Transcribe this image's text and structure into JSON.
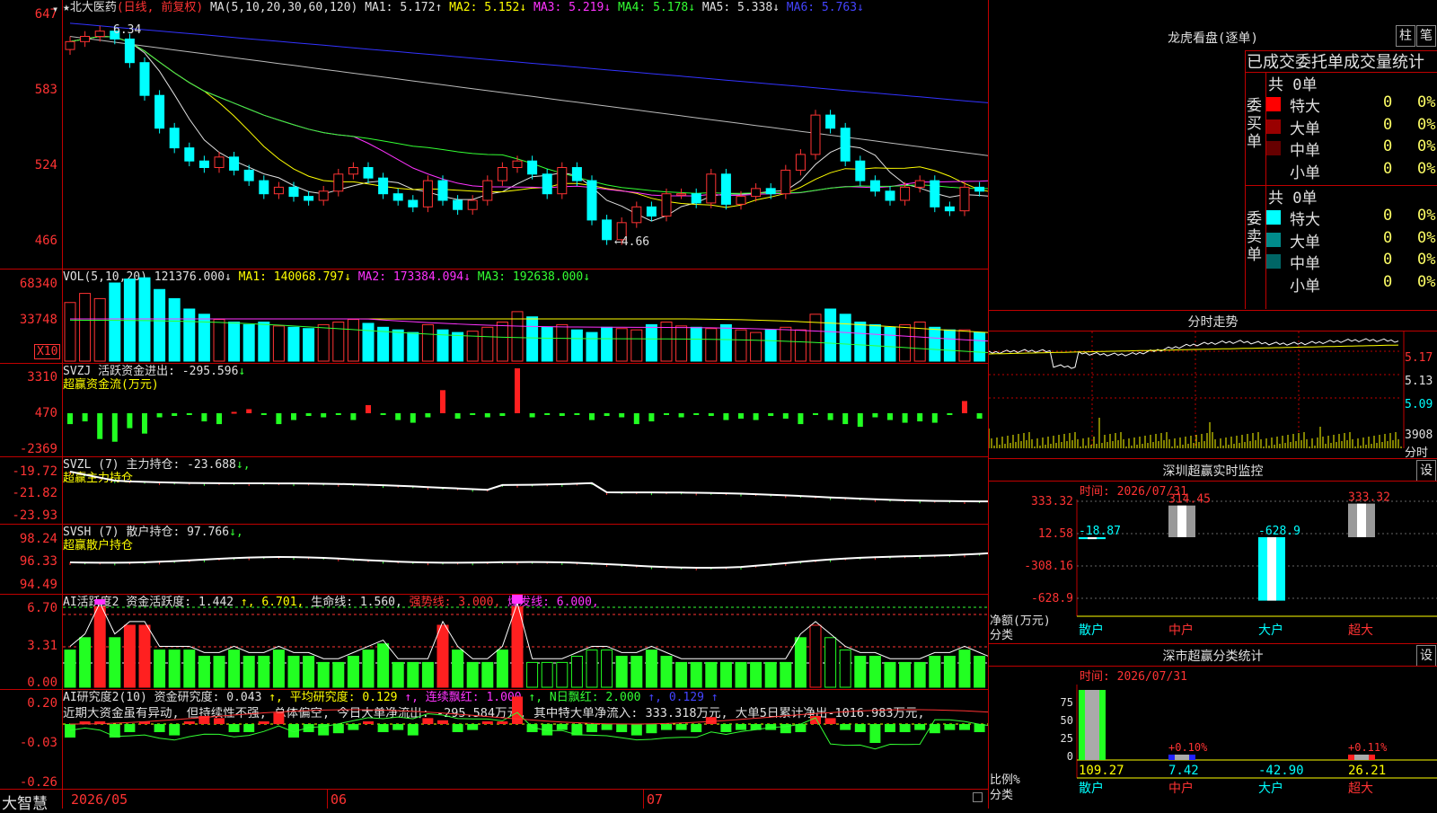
{
  "stock": {
    "star": "★",
    "name": "北大医药",
    "mode": "(日线, 前复权)"
  },
  "main_panel": {
    "ma_header": "MA(5,10,20,30,60,120)",
    "ma_values": [
      {
        "label": "MA1: 5.172",
        "arrow": "↑",
        "color": "#e0e0e0"
      },
      {
        "label": "MA2: 5.152",
        "arrow": "↓",
        "color": "#ffff00"
      },
      {
        "label": "MA3: 5.219",
        "arrow": "↓",
        "color": "#ff33ff"
      },
      {
        "label": "MA4: 5.178",
        "arrow": "↓",
        "color": "#33ff33"
      },
      {
        "label": "MA5: 5.338",
        "arrow": "↓",
        "color": "#e0e0e0"
      },
      {
        "label": "MA6: 5.763",
        "arrow": "↓",
        "color": "#4444ff"
      }
    ],
    "y_labels": [
      "647",
      "583",
      "524",
      "466"
    ],
    "high_note": "6.34",
    "low_note": "←4.66"
  },
  "vol_panel": {
    "header": "VOL(5,10,20)",
    "values": [
      {
        "label": "121376.000",
        "arrow": "↓",
        "color": "#e0e0e0"
      },
      {
        "label": "MA1: 140068.797",
        "arrow": "↓",
        "color": "#ffff00"
      },
      {
        "label": "MA2: 173384.094",
        "arrow": "↓",
        "color": "#ff33ff"
      },
      {
        "label": "MA3: 192638.000",
        "arrow": "↓",
        "color": "#33ff33"
      }
    ],
    "y_labels": [
      "68340",
      "33748"
    ],
    "unit": "X10"
  },
  "svzj_panel": {
    "title": "SVZJ  活跃资金进出: -295.596",
    "arrow": "↓",
    "subtitle": "超赢资金流(万元)",
    "y_labels": [
      "3310",
      "470",
      "-2369"
    ]
  },
  "svzl_panel": {
    "title": "SVZL (7) 主力持仓: -23.688",
    "arrow": "↓,",
    "subtitle": "超赢主力持仓",
    "y_labels": [
      "-19.72",
      "-21.82",
      "-23.93"
    ]
  },
  "svsh_panel": {
    "title": "SVSH (7) 散户持仓: 97.766",
    "arrow": "↓,",
    "subtitle": "超赢散户持仓",
    "y_labels": [
      "98.24",
      "96.33",
      "94.49"
    ]
  },
  "ai2_panel": {
    "parts": [
      {
        "label": "AI活跃度2 资金活跃度: 1.442",
        "color": "#e0e0e0"
      },
      {
        "label": "↑, 6.701,",
        "color": "#ffff00"
      },
      {
        "label": "生命线: 1.560,",
        "color": "#e0e0e0"
      },
      {
        "label": "强势线: 3.000,",
        "color": "#ff3333"
      },
      {
        "label": "爆发线: 6.000,",
        "color": "#ff33ff"
      }
    ],
    "y_labels": [
      "6.70",
      "3.31",
      "0.00"
    ]
  },
  "ai_research_panel": {
    "parts": [
      {
        "label": "AI研究度2(10) 资金研究度: 0.043",
        "color": "#e0e0e0"
      },
      {
        "label": "↑, 平均研究度: 0.129",
        "color": "#ffff00"
      },
      {
        "label": "↑, 连续飘红: 1.000",
        "color": "#ff33ff"
      },
      {
        "label": "↑, N日飘红: 2.000",
        "color": "#33ff33"
      },
      {
        "label": "↑, 0.129",
        "color": "#4444ff"
      },
      {
        "label": "↑",
        "color": "#4444ff"
      }
    ],
    "comment": "近期大资金虽有异动, 但持续性不强, 总体偏空, 今日大单净流出: -295.584万元, 其中特大单净流入: 333.318万元, 大单5日累计净出-1016.983万元,",
    "y_labels": [
      "0.20",
      "-0.03",
      "-0.26"
    ]
  },
  "bottom": {
    "brand": "大智慧",
    "dates": [
      "2026/05",
      "06",
      "07"
    ]
  },
  "lhb": {
    "title": "龙虎看盘(逐单)",
    "btn_bar": "柱",
    "btn_pen": "笔",
    "subtitle": "已成交委托单成交量统计",
    "buy": {
      "label": "委买单",
      "total": "共 0单",
      "rows": [
        {
          "name": "特大",
          "v1": "0",
          "v2": "0%",
          "color": "#ff0000"
        },
        {
          "name": "大单",
          "v1": "0",
          "v2": "0%",
          "color": "#990000"
        },
        {
          "name": "中单",
          "v1": "0",
          "v2": "0%",
          "color": "#660000"
        },
        {
          "name": "小单",
          "v1": "0",
          "v2": "0%",
          "color": "#000000"
        }
      ]
    },
    "sell": {
      "label": "委卖单",
      "total": "共 0单",
      "rows": [
        {
          "name": "特大",
          "v1": "0",
          "v2": "0%",
          "color": "#00ffff"
        },
        {
          "name": "大单",
          "v1": "0",
          "v2": "0%",
          "color": "#008c8c"
        },
        {
          "name": "中单",
          "v1": "0",
          "v2": "0%",
          "color": "#006666"
        },
        {
          "name": "小单",
          "v1": "0",
          "v2": "0%",
          "color": "#000000"
        }
      ]
    }
  },
  "intraday": {
    "title": "分时走势",
    "y_labels": [
      "5.17",
      "5.13",
      "5.09"
    ],
    "vol_label": "3908",
    "vol_unit": "分时"
  },
  "sz_monitor": {
    "title": "深圳超赢实时监控",
    "btn": "设",
    "time": "时间: 2026/07/31",
    "y_labels": [
      "333.32",
      "12.58",
      "-308.16",
      "-628.9"
    ],
    "axis_title": "净额(万元)",
    "axis_sub": "分类",
    "categories": [
      "散户",
      "中户",
      "大户",
      "超大"
    ],
    "values": [
      -18.87,
      314.45,
      -628.9,
      333.32
    ],
    "value_labels": [
      "-18.87",
      "314.45",
      "-628.9",
      "333.32"
    ]
  },
  "sz_class": {
    "title": "深市超赢分类统计",
    "btn": "设",
    "time": "时间: 2026/07/31",
    "y_labels": [
      "75",
      "50",
      "25",
      "0"
    ],
    "axis_title": "比例%",
    "axis_sub": "分类",
    "categories": [
      "散户",
      "中户",
      "大户",
      "超大"
    ],
    "bottom_values": [
      "109.27",
      "7.42",
      "-42.90",
      "26.21"
    ],
    "pct_labels": [
      "",
      "+0.10%",
      "",
      "+0.11%"
    ],
    "percents": [
      100,
      0.1,
      0,
      0.11
    ]
  },
  "chart_data": [
    {
      "type": "candlestick",
      "title": "北大医药 (日线, 前复权)",
      "ylim": [
        4.66,
        6.47
      ],
      "high": 6.34,
      "low": 4.66,
      "close": [
        6.26,
        6.3,
        6.34,
        6.28,
        6.1,
        5.85,
        5.6,
        5.45,
        5.35,
        5.3,
        5.38,
        5.28,
        5.2,
        5.1,
        5.15,
        5.08,
        5.05,
        5.12,
        5.25,
        5.3,
        5.22,
        5.1,
        5.05,
        5.0,
        5.2,
        5.05,
        4.98,
        5.05,
        5.2,
        5.3,
        5.35,
        5.25,
        5.1,
        5.3,
        5.2,
        4.9,
        4.75,
        4.88,
        5.0,
        4.93,
        5.1,
        5.1,
        5.03,
        5.25,
        5.02,
        5.08,
        5.14,
        5.1,
        5.28,
        5.4,
        5.7,
        5.6,
        5.35,
        5.2,
        5.12,
        5.05,
        5.15,
        5.2,
        5.0,
        4.97,
        5.15,
        5.12,
        5.15,
        5.2,
        5.12,
        5.14
      ],
      "open": [
        6.2,
        6.26,
        6.3,
        6.34,
        6.28,
        6.1,
        5.85,
        5.6,
        5.45,
        5.35,
        5.3,
        5.38,
        5.28,
        5.2,
        5.1,
        5.15,
        5.08,
        5.05,
        5.12,
        5.25,
        5.3,
        5.22,
        5.1,
        5.05,
        5.0,
        5.2,
        5.05,
        4.98,
        5.05,
        5.2,
        5.3,
        5.35,
        5.25,
        5.1,
        5.3,
        5.2,
        4.9,
        4.75,
        4.88,
        5.0,
        4.93,
        5.1,
        5.1,
        5.03,
        5.25,
        5.02,
        5.08,
        5.14,
        5.1,
        5.28,
        5.4,
        5.7,
        5.6,
        5.35,
        5.2,
        5.12,
        5.05,
        5.15,
        5.2,
        5.0,
        4.97,
        5.15,
        5.12,
        5.15,
        5.2,
        5.12
      ]
    },
    {
      "type": "bar",
      "title": "VOL(5,10,20)",
      "values": [
        45,
        52,
        48,
        60,
        63,
        64,
        55,
        48,
        40,
        36,
        32,
        30,
        28,
        30,
        27,
        26,
        25,
        28,
        30,
        32,
        29,
        26,
        24,
        22,
        28,
        24,
        22,
        23,
        26,
        30,
        38,
        34,
        26,
        28,
        24,
        22,
        26,
        25,
        24,
        28,
        30,
        27,
        26,
        25,
        28,
        24,
        22,
        24,
        26,
        24,
        36,
        40,
        36,
        30,
        28,
        26,
        28,
        30,
        26,
        24,
        24,
        22,
        22,
        24,
        22,
        18
      ],
      "ylim": [
        0,
        68340
      ]
    },
    {
      "type": "bar",
      "title": "SVZJ 活跃资金进出",
      "values": [
        -800,
        -600,
        -1900,
        -2100,
        -1100,
        -1500,
        -300,
        -200,
        -100,
        -600,
        -800,
        100,
        300,
        -100,
        -800,
        -500,
        -200,
        -300,
        -100,
        -500,
        600,
        -100,
        -500,
        -700,
        -300,
        1700,
        -400,
        -100,
        -300,
        -200,
        3310,
        -300,
        -100,
        -200,
        -100,
        -500,
        -200,
        -300,
        -800,
        -600,
        -100,
        -300,
        -100,
        -200,
        -500,
        -400,
        -500,
        -200,
        -400,
        -800,
        -100,
        -500,
        -800,
        -1000,
        -300,
        -500,
        -700,
        -600,
        -700,
        -100,
        900,
        -400,
        -300,
        -300,
        300,
        -295
      ],
      "ylim": [
        -2369,
        3310
      ]
    },
    {
      "type": "line",
      "title": "SVZL 主力持仓",
      "ylim": [
        -23.93,
        -19.72
      ]
    },
    {
      "type": "line",
      "title": "SVSH 散户持仓",
      "ylim": [
        94.49,
        98.24
      ]
    },
    {
      "type": "bar",
      "title": "AI活跃度2",
      "ylim": [
        0,
        6.7
      ]
    },
    {
      "type": "bar",
      "title": "AI研究度2(10)",
      "ylim": [
        -0.26,
        0.2
      ]
    }
  ]
}
